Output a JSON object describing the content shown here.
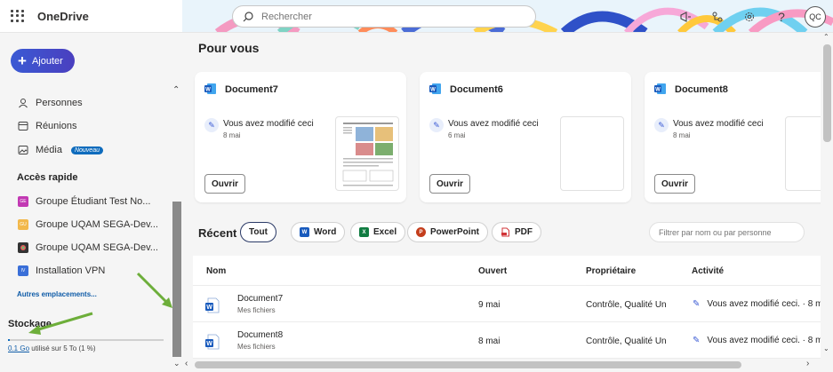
{
  "app": {
    "name": "OneDrive",
    "accent": "#0f6cbd"
  },
  "search": {
    "placeholder": "Rechercher"
  },
  "header_icons": [
    "megaphone-icon",
    "share-network-icon",
    "settings-icon",
    "help-icon"
  ],
  "user": {
    "initials": "QC"
  },
  "sidebar": {
    "add_label": "Ajouter",
    "nav": [
      {
        "label": "Personnes",
        "icon": "people-icon"
      },
      {
        "label": "Réunions",
        "icon": "calendar-icon"
      },
      {
        "label": "Média",
        "icon": "image-icon",
        "badge": "Nouveau"
      }
    ],
    "quick_access_title": "Accès rapide",
    "quick_access": [
      {
        "label": "Groupe Étudiant Test No...",
        "color": "#c239b3",
        "glyph": "GE"
      },
      {
        "label": "Groupe UQAM SEGA-Dev...",
        "color": "#f2b84b",
        "glyph": "GU"
      },
      {
        "label": "Groupe UQAM SEGA-Dev...",
        "color": "#333333",
        "glyph": ""
      },
      {
        "label": "Installation VPN",
        "color": "#3a6fd8",
        "glyph": "IV"
      }
    ],
    "more_places": "Autres emplacements...",
    "storage": {
      "title": "Stockage",
      "used": "0.1 Go",
      "text": " utilisé sur 5 To (1 %)",
      "percent": 1
    }
  },
  "main": {
    "for_you_title": "Pour vous",
    "cards": [
      {
        "title": "Document7",
        "activity": "Vous avez modifié ceci",
        "date": "8 mai",
        "open_label": "Ouvrir",
        "has_preview": true
      },
      {
        "title": "Document6",
        "activity": "Vous avez modifié ceci",
        "date": "6 mai",
        "open_label": "Ouvrir",
        "has_preview": false
      },
      {
        "title": "Document8",
        "activity": "Vous avez modifié ceci",
        "date": "8 mai",
        "open_label": "Ouvrir",
        "has_preview": false
      }
    ],
    "recent_title": "Récent",
    "filters": [
      {
        "label": "Tout",
        "active": true
      },
      {
        "label": "Word",
        "color": "#185abd",
        "glyph": "W"
      },
      {
        "label": "Excel",
        "color": "#107c41",
        "glyph": "X"
      },
      {
        "label": "PowerPoint",
        "color": "#c43e1c",
        "glyph": "P"
      },
      {
        "label": "PDF",
        "color": "#d13438",
        "glyph": ""
      }
    ],
    "filter_placeholder": "Filtrer par nom ou par personne",
    "table": {
      "columns": [
        "Nom",
        "Ouvert",
        "Propriétaire",
        "Activité"
      ],
      "rows": [
        {
          "name": "Document7",
          "location": "Mes fichiers",
          "opened": "9 mai",
          "owner": "Contrôle, Qualité Un",
          "activity": "Vous avez modifié ceci. · 8 m"
        },
        {
          "name": "Document8",
          "location": "Mes fichiers",
          "opened": "8 mai",
          "owner": "Contrôle, Qualité Un",
          "activity": "Vous avez modifié ceci. · 8 m"
        }
      ]
    }
  }
}
